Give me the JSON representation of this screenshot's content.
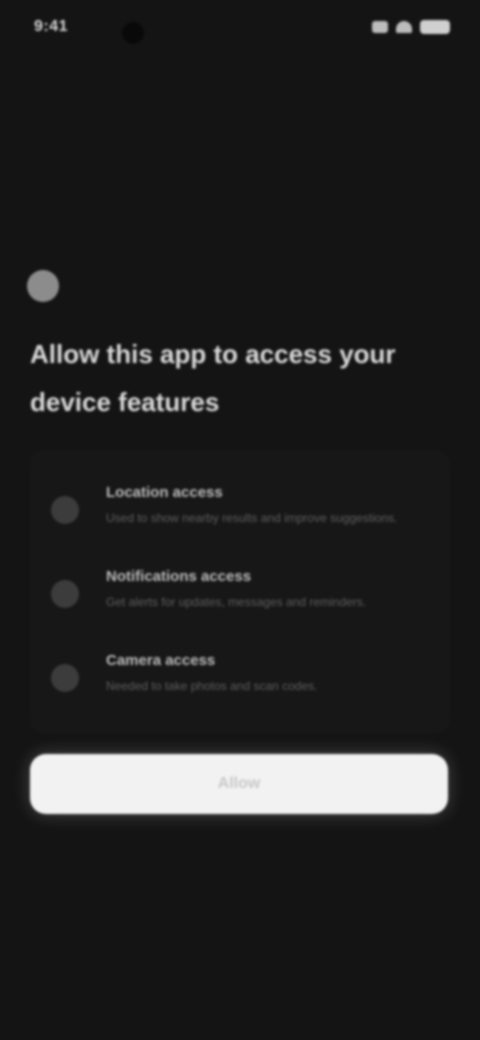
{
  "status_bar": {
    "time": "9:41"
  },
  "app": {
    "icon": "app-logo-icon"
  },
  "title": "Allow this app to access your device features",
  "permissions": [
    {
      "icon": "location-icon",
      "title": "Location access",
      "description": "Used to show nearby results and improve suggestions."
    },
    {
      "icon": "notification-icon",
      "title": "Notifications access",
      "description": "Get alerts for updates, messages and reminders."
    },
    {
      "icon": "camera-icon",
      "title": "Camera access",
      "description": "Needed to take photos and scan codes."
    }
  ],
  "primary_button": {
    "label": "Allow"
  }
}
